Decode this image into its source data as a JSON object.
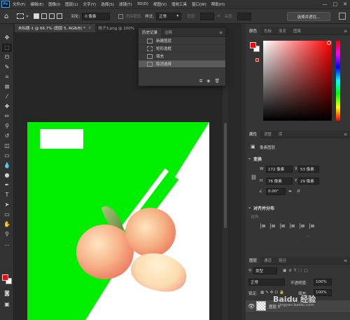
{
  "menubar": {
    "logo": "Ps",
    "items": [
      "文件(F)",
      "编辑(E)",
      "图像(I)",
      "图层(L)",
      "文字(Y)",
      "选择(S)",
      "滤镜(T)",
      "3D(D)",
      "视图(V)",
      "增效工具",
      "窗口(W)",
      "帮助(H)"
    ],
    "window_controls": [
      "—",
      "□",
      "✕"
    ]
  },
  "options": {
    "feather_label": "羽化:",
    "feather_value": "0 像素",
    "antialias_label": "消除锯齿",
    "style_label": "样式:",
    "style_value": "正常",
    "width_label": "宽度:",
    "height_label": "高度:",
    "select_subject_button": "选择并遮住..."
  },
  "tabs": {
    "doc1": "未标题-1 @ 66.7% (图层 5, RGB/8) *",
    "doc2": "桃子3.png @ 100%"
  },
  "history": {
    "tab_history": "历史记录",
    "tab_notes": "注释",
    "items": [
      "新建图层",
      "矩形选框",
      "填充",
      "取消选择"
    ]
  },
  "color_panel": {
    "tabs": [
      "颜色",
      "色板",
      "渐变",
      "图案"
    ],
    "foreground": "#ff0000",
    "background": "#ffffff"
  },
  "properties": {
    "tabs": [
      "属性",
      "调整",
      "库"
    ],
    "layer_kind": "像素图层",
    "transform_title": "变换",
    "w_label": "W",
    "w_value": "172 像素",
    "h_label": "H",
    "h_value": "76 像素",
    "x_label": "X",
    "x_value": "53 像素",
    "y_label": "Y",
    "y_value": "29 像素",
    "angle_value": "0.00°",
    "align_title": "对齐并分布",
    "align_label": "对齐:"
  },
  "layers": {
    "tabs": [
      "图层",
      "通道",
      "路径"
    ],
    "filter_value": "类型",
    "blend_mode": "正常",
    "opacity_label": "不透明度:",
    "opacity_value": "100%",
    "lock_label": "锁定:",
    "fill_label": "填充:",
    "fill_value": "100%",
    "layer_name": "图层 5"
  },
  "watermark": {
    "text": "Baidu 经验",
    "sub": "jingyan.baidu.com"
  }
}
